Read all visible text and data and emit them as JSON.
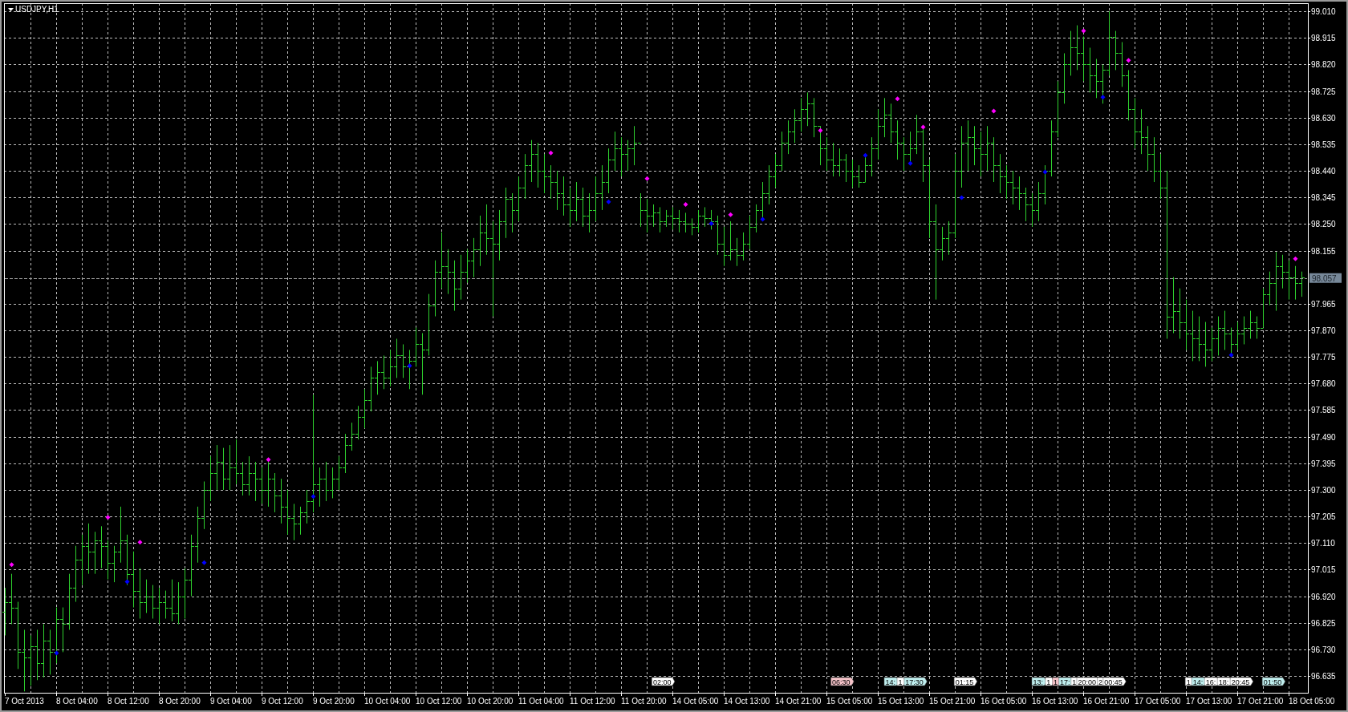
{
  "chart": {
    "title": "USDJPY,H1",
    "y_axis_labels": [
      "99.010",
      "98.915",
      "98.820",
      "98.725",
      "98.630",
      "98.535",
      "98.440",
      "98.345",
      "98.250",
      "98.155",
      "97.965",
      "97.870",
      "97.775",
      "97.680",
      "97.585",
      "97.490",
      "97.395",
      "97.300",
      "97.205",
      "97.110",
      "97.015",
      "96.920",
      "96.825",
      "96.730",
      "96.635"
    ],
    "x_axis_labels": [
      "7 Oct 2013",
      "8 Oct 04:00",
      "8 Oct 12:00",
      "8 Oct 20:00",
      "9 Oct 04:00",
      "9 Oct 12:00",
      "9 Oct 20:00",
      "10 Oct 04:00",
      "10 Oct 12:00",
      "10 Oct 20:00",
      "11 Oct 04:00",
      "11 Oct 12:00",
      "11 Oct 20:00",
      "14 Oct 05:00",
      "14 Oct 13:00",
      "14 Oct 21:00",
      "15 Oct 05:00",
      "15 Oct 13:00",
      "15 Oct 21:00",
      "16 Oct 05:00",
      "16 Oct 13:00",
      "16 Oct 21:00",
      "17 Oct 05:00",
      "17 Oct 13:00",
      "17 Oct 21:00",
      "18 Oct 05:00"
    ],
    "price_label": "98.057",
    "events": [
      {
        "label": "02:00",
        "color": "#ffffff"
      },
      {
        "label": "06:30",
        "color": "#f4c2c8"
      },
      {
        "label": "14:",
        "color": "#bfeeee"
      },
      {
        "label": "1",
        "color": "#ffffff"
      },
      {
        "label": "17:30",
        "color": "#bfeeee"
      },
      {
        "label": "01:15",
        "color": "#ffffff"
      },
      {
        "label": "13:",
        "color": "#bfeeee"
      },
      {
        "label": "1",
        "color": "#ffffff"
      },
      {
        "label": "1",
        "color": "#f4c2c8"
      },
      {
        "label": "17:",
        "color": "#bfeeee"
      },
      {
        "label": "1",
        "color": "#ffffff"
      },
      {
        "label": "20:00",
        "color": "#ffffff"
      },
      {
        "label": "2",
        "color": "#ffffff"
      },
      {
        "label": "00:45",
        "color": "#ffffff"
      },
      {
        "label": "1",
        "color": "#ffffff"
      },
      {
        "label": "14:",
        "color": "#bfeeee"
      },
      {
        "label": "16:",
        "color": "#ffffff"
      },
      {
        "label": "18:",
        "color": "#ffffff"
      },
      {
        "label": "20:45",
        "color": "#ffffff"
      },
      {
        "label": "01:50",
        "color": "#bfeeee"
      }
    ]
  }
}
